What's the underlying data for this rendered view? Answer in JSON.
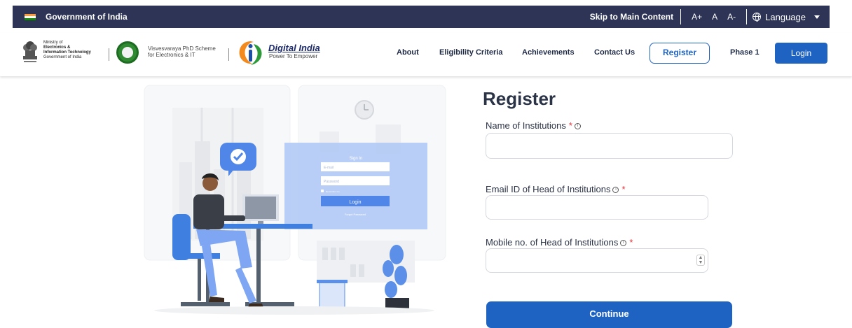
{
  "gov_bar": {
    "title": "Government of India",
    "skip": "Skip to Main Content",
    "font_sizes": [
      "A+",
      "A",
      "A-"
    ],
    "language": "Language"
  },
  "header": {
    "ministry_lines": [
      "Ministry of",
      "Electronics &",
      "Information Technology",
      "Government of India"
    ],
    "scheme_lines": [
      "Visvesvaraya PhD Scheme",
      "for Electronics & IT"
    ],
    "digital_india_title": "Digital India",
    "digital_india_tagline": "Power To Empower",
    "nav": [
      "About",
      "Eligibility Criteria",
      "Achievements",
      "Contact Us"
    ],
    "register": "Register",
    "phase": "Phase 1",
    "login": "Login"
  },
  "illustration": {
    "sign_in_title": "Sign In",
    "email_placeholder": "E-mail",
    "password_placeholder": "Password",
    "remember": "Remember me",
    "login_button": "Login",
    "forgot": "Forgot Password"
  },
  "form": {
    "title": "Register",
    "fields": [
      {
        "label": "Name of Institutions",
        "required_mark": "*",
        "value": ""
      },
      {
        "label": "Email ID of Head of Institutions",
        "required_mark": "*",
        "value": ""
      },
      {
        "label": "Mobile no. of Head of Institutions",
        "required_mark": "*",
        "value": ""
      }
    ],
    "continue": "Continue"
  },
  "colors": {
    "gov_bar": "#2d3456",
    "primary": "#1f63c2",
    "required": "#e0363b",
    "illustration_blue": "#5b8fe8"
  }
}
